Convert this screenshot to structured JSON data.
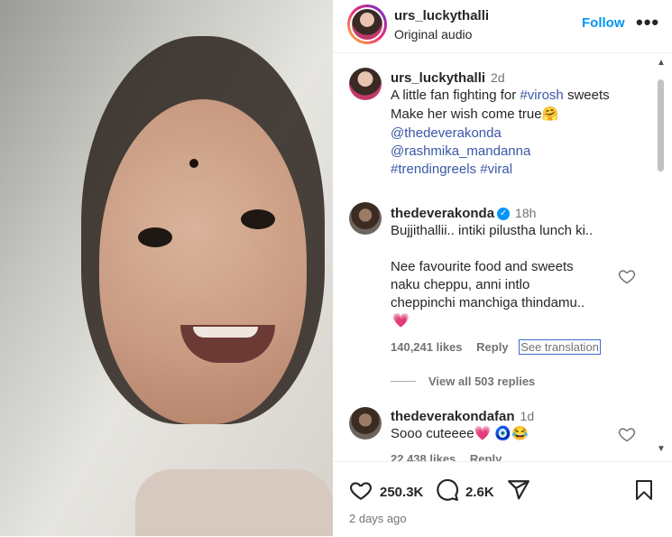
{
  "header": {
    "username": "urs_luckythalli",
    "audio": "Original audio",
    "follow_label": "Follow",
    "more_label": "•••"
  },
  "caption": {
    "username": "urs_luckythalli",
    "time": "2d",
    "line1": "A little fan fighting for",
    "hashtag1": "#virosh",
    "line1_end": " sweets",
    "line2": "Make her wish come true🤗",
    "mention1": "@thedeverakonda",
    "mention2": "@rashmika_mandanna",
    "hashtags": "#trendingreels #viral"
  },
  "comments": [
    {
      "username": "thedeverakonda",
      "verified": true,
      "time": "18h",
      "line1": "Bujjithallii.. intiki pilustha lunch ki..",
      "line2": "Nee favourite food and sweets",
      "line3": "naku cheppu, anni intlo",
      "line4": "cheppinchi manchiga thindamu..",
      "emoji": "💗",
      "likes": "140,241 likes",
      "reply": "Reply",
      "translate": "See translation",
      "view_replies": "View all 503 replies"
    },
    {
      "username": "thedeverakondafan",
      "time": "1d",
      "text": "Sooo cuteeee💗 🧿😂",
      "likes": "22,438 likes",
      "reply": "Reply"
    }
  ],
  "actions": {
    "likes": "250.3K",
    "comments": "2.6K",
    "date": "2 days ago"
  },
  "colors": {
    "accent": "#0095f6",
    "tag": "#3a58a8",
    "muted": "#737373"
  },
  "icons": [
    "heart-icon",
    "comment-icon",
    "share-icon",
    "bookmark-icon",
    "more-icon",
    "verified-icon"
  ]
}
